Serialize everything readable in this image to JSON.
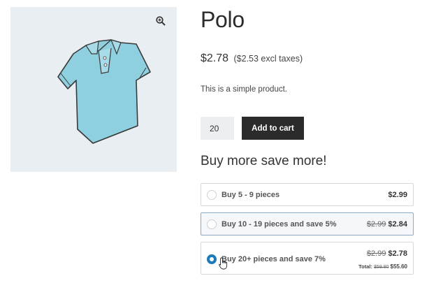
{
  "product": {
    "title": "Polo",
    "price": "$2.78",
    "price_excl": "($2.53 excl taxes)",
    "description": "This is a simple product."
  },
  "cart": {
    "quantity": "20",
    "add_label": "Add to cart"
  },
  "tiers": {
    "heading": "Buy more save more!",
    "items": [
      {
        "label": "Buy 5 - 9 pieces",
        "old_price": "",
        "price": "$2.99",
        "selected": false
      },
      {
        "label": "Buy 10 - 19 pieces and save 5%",
        "old_price": "$2.99",
        "price": "$2.84",
        "selected": false
      },
      {
        "label": "Buy 20+ pieces and save 7%",
        "old_price": "$2.99",
        "price": "$2.78",
        "selected": true,
        "total_label": "Total:",
        "total_old": "$59.80",
        "total_new": "$55.60"
      }
    ]
  },
  "icons": {
    "zoom": "zoom-in-icon",
    "image": "polo-shirt-image",
    "cursor": "hand-pointer-icon"
  },
  "colors": {
    "button_bg": "#2b2b2b",
    "radio_selected": "#1e7ab8",
    "gallery_bg": "#e9eef3",
    "shirt": "#8fd0e0"
  }
}
